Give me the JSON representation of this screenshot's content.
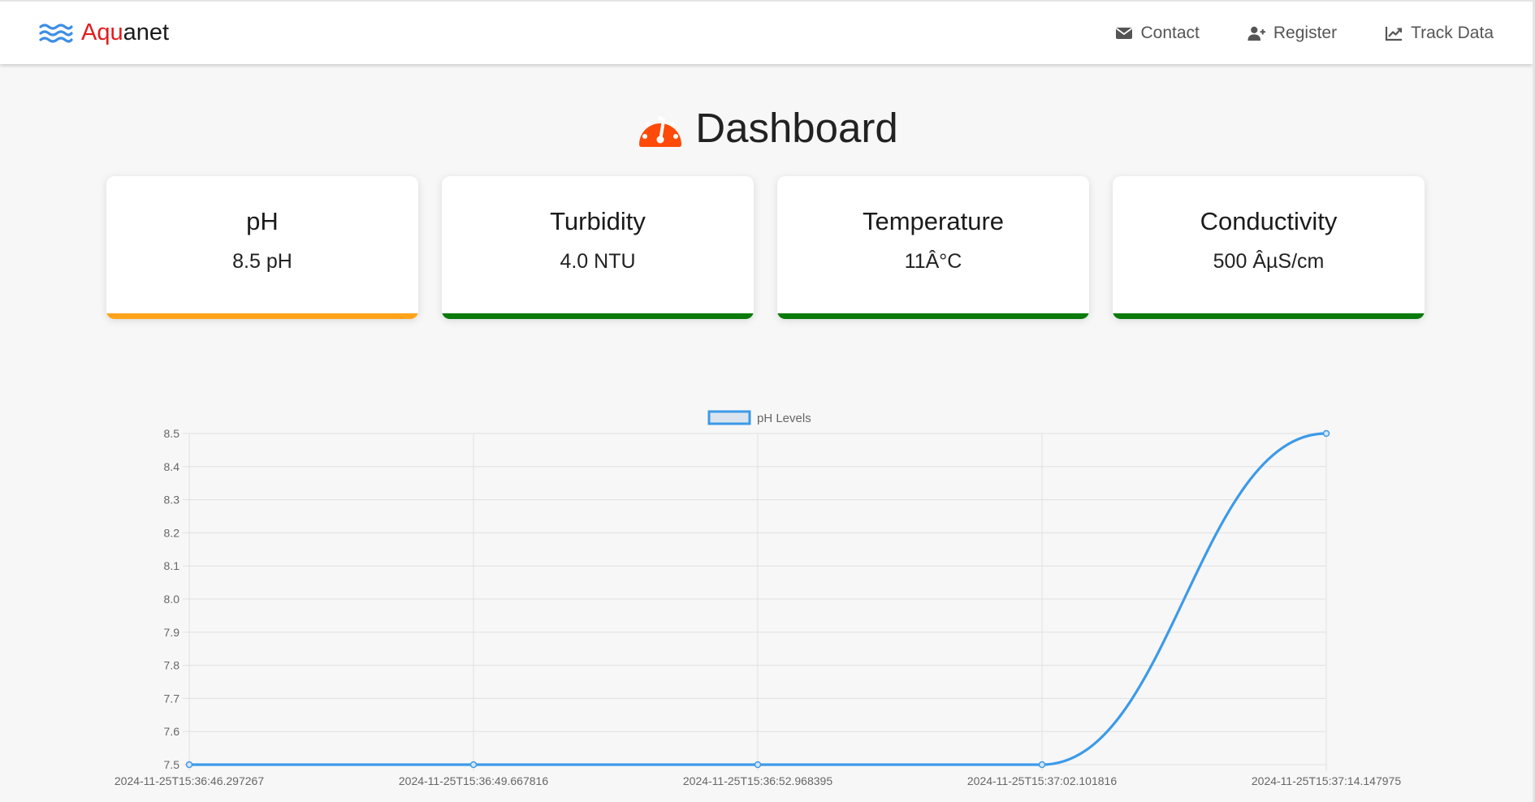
{
  "brand": {
    "part1": "Aqu",
    "part2": "anet",
    "accent_color": "#e21c1c",
    "icon": "water-waves-icon"
  },
  "nav": {
    "items": [
      {
        "label": "Contact",
        "icon": "envelope-icon"
      },
      {
        "label": "Register",
        "icon": "user-plus-icon"
      },
      {
        "label": "Track Data",
        "icon": "line-chart-icon"
      }
    ]
  },
  "page": {
    "title": "Dashboard",
    "icon": "gauge-icon",
    "icon_color": "#ff4a0a"
  },
  "cards": [
    {
      "label": "pH",
      "value": "8.5 pH",
      "status_color": "#ffa31a"
    },
    {
      "label": "Turbidity",
      "value": "4.0 NTU",
      "status_color": "#0a7a0a"
    },
    {
      "label": "Temperature",
      "value": "11Â°C",
      "status_color": "#0a7a0a"
    },
    {
      "label": "Conductivity",
      "value": "500 ÂµS/cm",
      "status_color": "#0a7a0a"
    }
  ],
  "chart_data": {
    "type": "line",
    "x": [
      "2024-11-25T15:36:46.297267",
      "2024-11-25T15:36:49.667816",
      "2024-11-25T15:36:52.968395",
      "2024-11-25T15:37:02.101816",
      "2024-11-25T15:37:14.147975"
    ],
    "series": [
      {
        "name": "pH Levels",
        "values": [
          7.5,
          7.5,
          7.5,
          7.5,
          8.5
        ],
        "color": "#3d9ae8"
      }
    ],
    "ylim": [
      7.5,
      8.5
    ],
    "yticks": [
      "7.5",
      "7.6",
      "7.7",
      "7.8",
      "7.9",
      "8.0",
      "8.1",
      "8.2",
      "8.3",
      "8.4",
      "8.5"
    ],
    "grid": true,
    "legend": "top-center",
    "smooth": true
  }
}
